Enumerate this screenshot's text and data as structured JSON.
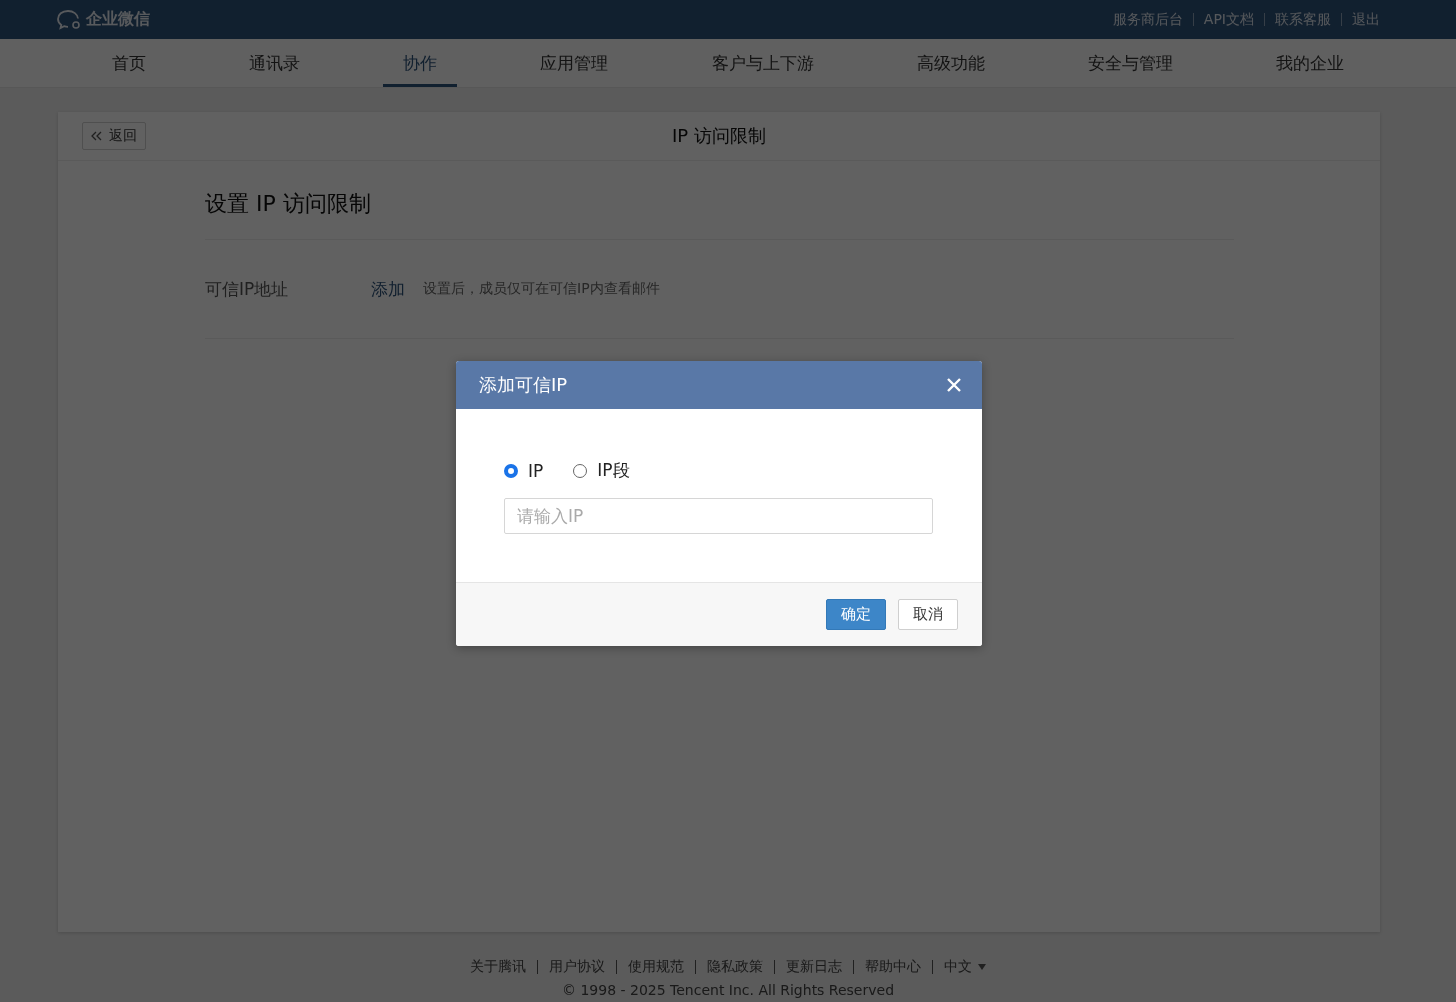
{
  "top_bar": {
    "logo_text": "企业微信",
    "links": [
      "服务商后台",
      "API文档",
      "联系客服",
      "退出"
    ]
  },
  "nav_tabs": [
    {
      "label": "首页",
      "selected": false
    },
    {
      "label": "通讯录",
      "selected": false
    },
    {
      "label": "协作",
      "selected": true
    },
    {
      "label": "应用管理",
      "selected": false
    },
    {
      "label": "客户与上下游",
      "selected": false
    },
    {
      "label": "高级功能",
      "selected": false
    },
    {
      "label": "安全与管理",
      "selected": false
    },
    {
      "label": "我的企业",
      "selected": false
    }
  ],
  "page": {
    "back_button": "返回",
    "title": "IP 访问限制",
    "section_title": "设置 IP 访问限制",
    "row": {
      "label": "可信IP地址",
      "action": "添加",
      "hint": "设置后，成员仅可在可信IP内查看邮件"
    }
  },
  "dialog": {
    "title": "添加可信IP",
    "options": [
      {
        "label": "IP",
        "selected": true
      },
      {
        "label": "IP段",
        "selected": false
      }
    ],
    "input": {
      "placeholder": "请输入IP"
    },
    "buttons": [
      {
        "label": "确定",
        "kind": "primary"
      },
      {
        "label": "取消",
        "kind": "secondary"
      }
    ]
  },
  "footer": {
    "links": [
      "关于腾讯",
      "用户协议",
      "使用规范",
      "隐私政策",
      "更新日志",
      "帮助中心"
    ],
    "language": "中文",
    "copyright": "© 1998 - 2025 Tencent Inc. All Rights Reserved"
  }
}
